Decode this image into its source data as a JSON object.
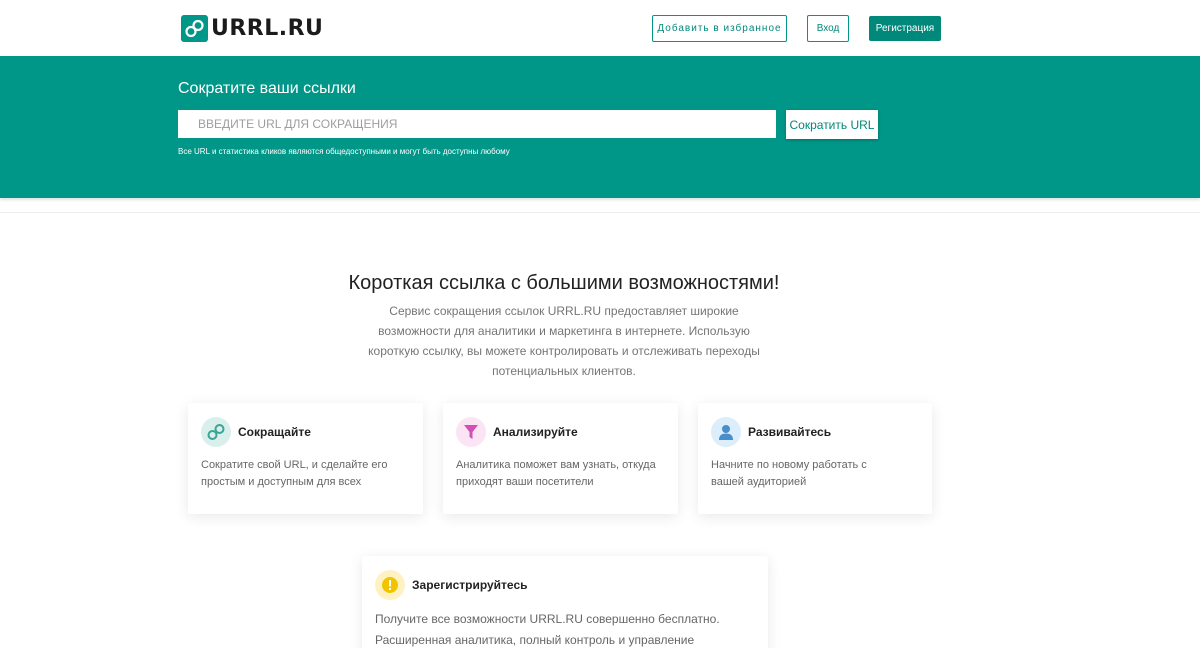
{
  "header": {
    "logo_text": "URRL.RU",
    "favorites_label": "Добавить в избранное",
    "login_label": "Вход",
    "register_label": "Регистрация"
  },
  "hero": {
    "title": "Сократите ваши ссылки",
    "input_placeholder": "ВВЕДИТЕ URL ДЛЯ СОКРАЩЕНИЯ",
    "input_value": "",
    "button_label": "Сократить URL",
    "note": "Все URL и статистика кликов являются общедоступными и могут быть доступны любому"
  },
  "intro": {
    "title": "Короткая ссылка с большими возможностями!",
    "description": "Сервис сокращения ссылок URRL.RU предоставляет широкие возможности для аналитики и маркетинга в интернете. Использую короткую ссылку, вы можете контролировать и отслеживать переходы потенциальных клиентов."
  },
  "features": [
    {
      "icon": "link-icon",
      "title": "Сокращайте",
      "text": "Сократите свой URL, и сделайте его простым и доступным для всех"
    },
    {
      "icon": "funnel-icon",
      "title": "Анализируйте",
      "text": "Аналитика поможет вам узнать, откуда приходят ваши посетители"
    },
    {
      "icon": "user-icon",
      "title": "Развивайтесь",
      "text": "Начните по новому работать с вашей аудиторией"
    },
    {
      "icon": "exclamation-icon",
      "title": "Зарегистрируйтесь",
      "text": "Получите все возможности URRL.RU совершенно бесплатно. Расширенная аналитика, полный контроль и управление вашими"
    }
  ],
  "colors": {
    "brand": "#009688",
    "brand_dark": "#00897b",
    "link_icon_bg": "#d8efec",
    "funnel_icon_bg": "#fbe4f4",
    "user_icon_bg": "#dcedfb",
    "warn_icon_bg": "#fff2c2"
  }
}
